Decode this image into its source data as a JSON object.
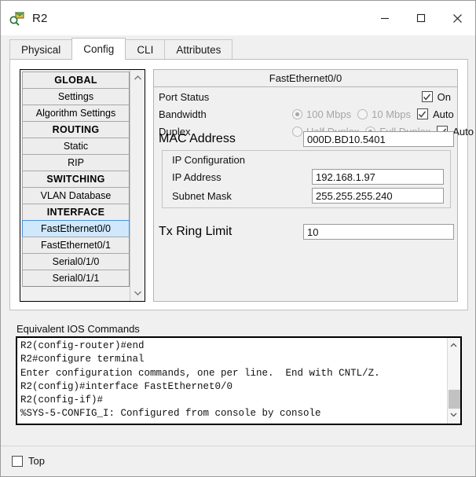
{
  "window": {
    "title": "R2",
    "icon": "packet-tracer-router-icon",
    "controls": {
      "minimize": "minimize-icon",
      "maximize": "maximize-icon",
      "close": "close-icon"
    }
  },
  "tabs": [
    {
      "label": "Physical",
      "active": false
    },
    {
      "label": "Config",
      "active": true
    },
    {
      "label": "CLI",
      "active": false
    },
    {
      "label": "Attributes",
      "active": false
    }
  ],
  "sidebar": {
    "items": [
      {
        "label": "GLOBAL",
        "type": "header",
        "selected": false
      },
      {
        "label": "Settings",
        "type": "item",
        "selected": false
      },
      {
        "label": "Algorithm Settings",
        "type": "item",
        "selected": false
      },
      {
        "label": "ROUTING",
        "type": "header",
        "selected": false
      },
      {
        "label": "Static",
        "type": "item",
        "selected": false
      },
      {
        "label": "RIP",
        "type": "item",
        "selected": false
      },
      {
        "label": "SWITCHING",
        "type": "header",
        "selected": false
      },
      {
        "label": "VLAN Database",
        "type": "item",
        "selected": false
      },
      {
        "label": "INTERFACE",
        "type": "header",
        "selected": false
      },
      {
        "label": "FastEthernet0/0",
        "type": "item",
        "selected": true
      },
      {
        "label": "FastEthernet0/1",
        "type": "item",
        "selected": false
      },
      {
        "label": "Serial0/1/0",
        "type": "item",
        "selected": false
      },
      {
        "label": "Serial0/1/1",
        "type": "item",
        "selected": false
      }
    ],
    "scroll": {
      "up": "chevron-up-icon",
      "down": "chevron-down-icon"
    }
  },
  "config": {
    "header": "FastEthernet0/0",
    "port_status": {
      "label": "Port Status",
      "checkbox_label": "On",
      "checked": true
    },
    "bandwidth": {
      "label": "Bandwidth",
      "options": [
        {
          "label": "100 Mbps",
          "selected": true
        },
        {
          "label": "10 Mbps",
          "selected": false
        }
      ],
      "auto_label": "Auto",
      "auto_checked": true,
      "disabled": true
    },
    "duplex": {
      "label": "Duplex",
      "options": [
        {
          "label": "Half Duplex",
          "selected": false
        },
        {
          "label": "Full Duplex",
          "selected": true
        }
      ],
      "auto_label": "Auto",
      "auto_checked": true,
      "disabled": true
    },
    "mac_address": {
      "label": "MAC Address",
      "value": "000D.BD10.5401"
    },
    "ip_configuration": {
      "title": "IP Configuration",
      "ip_address": {
        "label": "IP Address",
        "value": "192.168.1.97"
      },
      "subnet_mask": {
        "label": "Subnet Mask",
        "value": "255.255.255.240"
      }
    },
    "tx_ring_limit": {
      "label": "Tx Ring Limit",
      "value": "10"
    }
  },
  "ios": {
    "label": "Equivalent IOS Commands",
    "lines": [
      "R2(config-router)#end",
      "R2#configure terminal",
      "Enter configuration commands, one per line.  End with CNTL/Z.",
      "R2(config)#interface FastEthernet0/0",
      "R2(config-if)#",
      "%SYS-5-CONFIG_I: Configured from console by console"
    ],
    "scroll": {
      "up": "chevron-up-icon",
      "down": "chevron-down-icon"
    }
  },
  "footer": {
    "top_checkbox": {
      "label": "Top",
      "checked": false
    }
  },
  "colors": {
    "selection": "#cfe8fb",
    "selection_border": "#4a90d9",
    "window_bg": "#f0f0f0",
    "field_bg": "#ffffff"
  }
}
